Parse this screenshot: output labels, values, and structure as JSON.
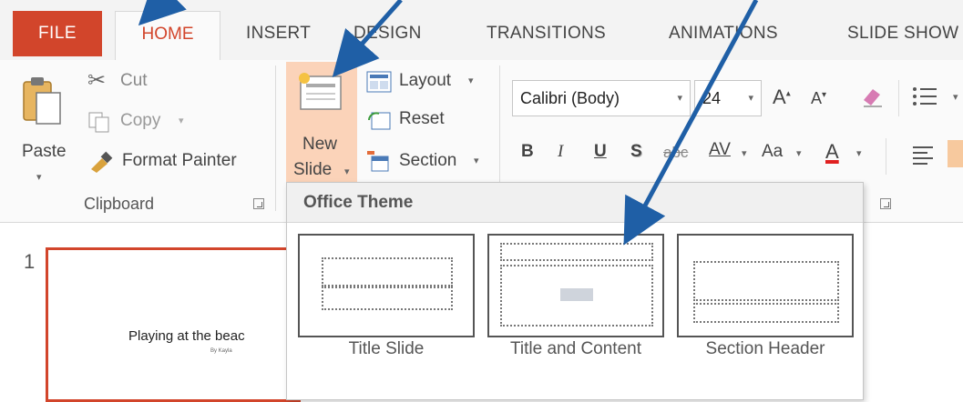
{
  "tabs": {
    "file": "FILE",
    "home": "HOME",
    "insert": "INSERT",
    "design": "DESIGN",
    "transitions": "TRANSITIONS",
    "animations": "ANIMATIONS",
    "slideshow": "SLIDE SHOW"
  },
  "clipboard": {
    "cut": "Cut",
    "copy": "Copy",
    "paste": "Paste",
    "format_painter": "Format Painter",
    "group_label": "Clipboard"
  },
  "slides": {
    "new_line1": "New",
    "new_line2": "Slide",
    "layout": "Layout",
    "reset": "Reset",
    "section": "Section"
  },
  "font": {
    "name": "Calibri (Body)",
    "size": "24",
    "bold": "B",
    "italic": "I",
    "underline": "U",
    "shadow": "S",
    "strike": "abc",
    "spacing": "AV",
    "case": "Aa",
    "color": "A"
  },
  "gallery": {
    "title": "Office Theme",
    "layouts": [
      "Title Slide",
      "Title and Content",
      "Section Header"
    ]
  },
  "thumbnail": {
    "number": "1",
    "title": "Playing at the beac",
    "subtitle": "By Kayla"
  },
  "colors": {
    "accent": "#d2452b",
    "arrow": "#1f5fa6"
  }
}
